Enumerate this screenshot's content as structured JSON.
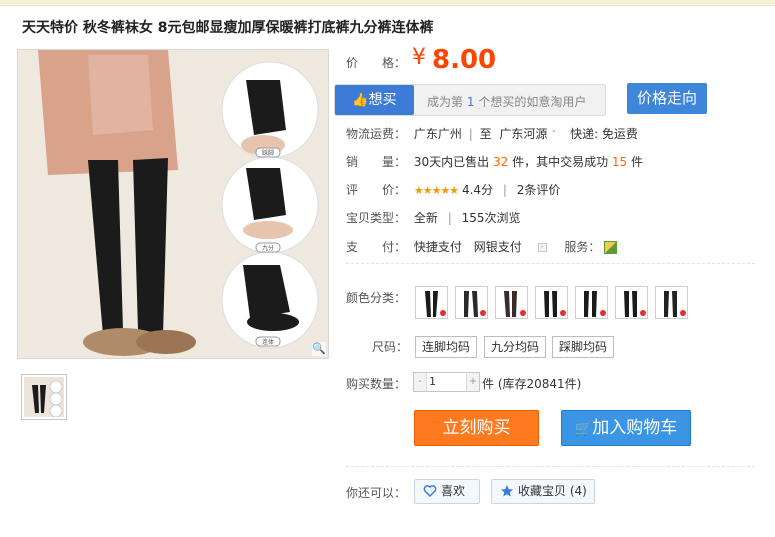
{
  "title": "天天特价 秋冬裤袜女 8元包邮显瘦加厚保暖裤打底裤九分裤连体裤",
  "image_labels": [
    "踩脚",
    "九分",
    "连体"
  ],
  "price": {
    "label": "价　　格：",
    "symbol": "¥",
    "value": "8.00"
  },
  "want": {
    "button": "想买",
    "prefix": "成为第",
    "count": "1",
    "suffix": "个想买的如意淘用户"
  },
  "trend_button": "价格走向",
  "shipping": {
    "label": "物流运费：",
    "from": "广东广州",
    "sep": "|",
    "to_prefix": "至",
    "to": "广东河源",
    "arrow": "ˇ",
    "fee": "快递: 免运费"
  },
  "sales": {
    "label": "销　　量：",
    "prefix": "30天内已售出",
    "sold": "32",
    "mid": "件，其中交易成功",
    "success": "15",
    "suffix": "件"
  },
  "rating": {
    "label": "评　　价：",
    "stars": "★★★★★",
    "score": "4.4分",
    "sep": "|",
    "reviews": "2条评价"
  },
  "type": {
    "label": "宝贝类型：",
    "value": "全新",
    "sep": "|",
    "views": "155次浏览"
  },
  "payment": {
    "label": "支　　付：",
    "m1": "快捷支付",
    "m2": "网银支付",
    "service_label": "服务："
  },
  "colors": {
    "label": "颜色分类："
  },
  "size": {
    "label": "尺码：",
    "options": [
      "连脚均码",
      "九分均码",
      "踩脚均码"
    ]
  },
  "quantity": {
    "label": "购买数量：",
    "minus": "-",
    "value": "1",
    "plus": "+",
    "stock": "件 (库存20841件)"
  },
  "buy_button": "立刻购买",
  "cart_button": "加入购物车",
  "also": {
    "label": "你还可以：",
    "like": "喜欢",
    "fav": "收藏宝贝 (4)"
  },
  "colors_theme": {
    "price": "#ff4400",
    "accent_blue": "#3d7cd6",
    "buy_orange": "#ff7a1e",
    "cart_blue": "#3a95e4"
  }
}
